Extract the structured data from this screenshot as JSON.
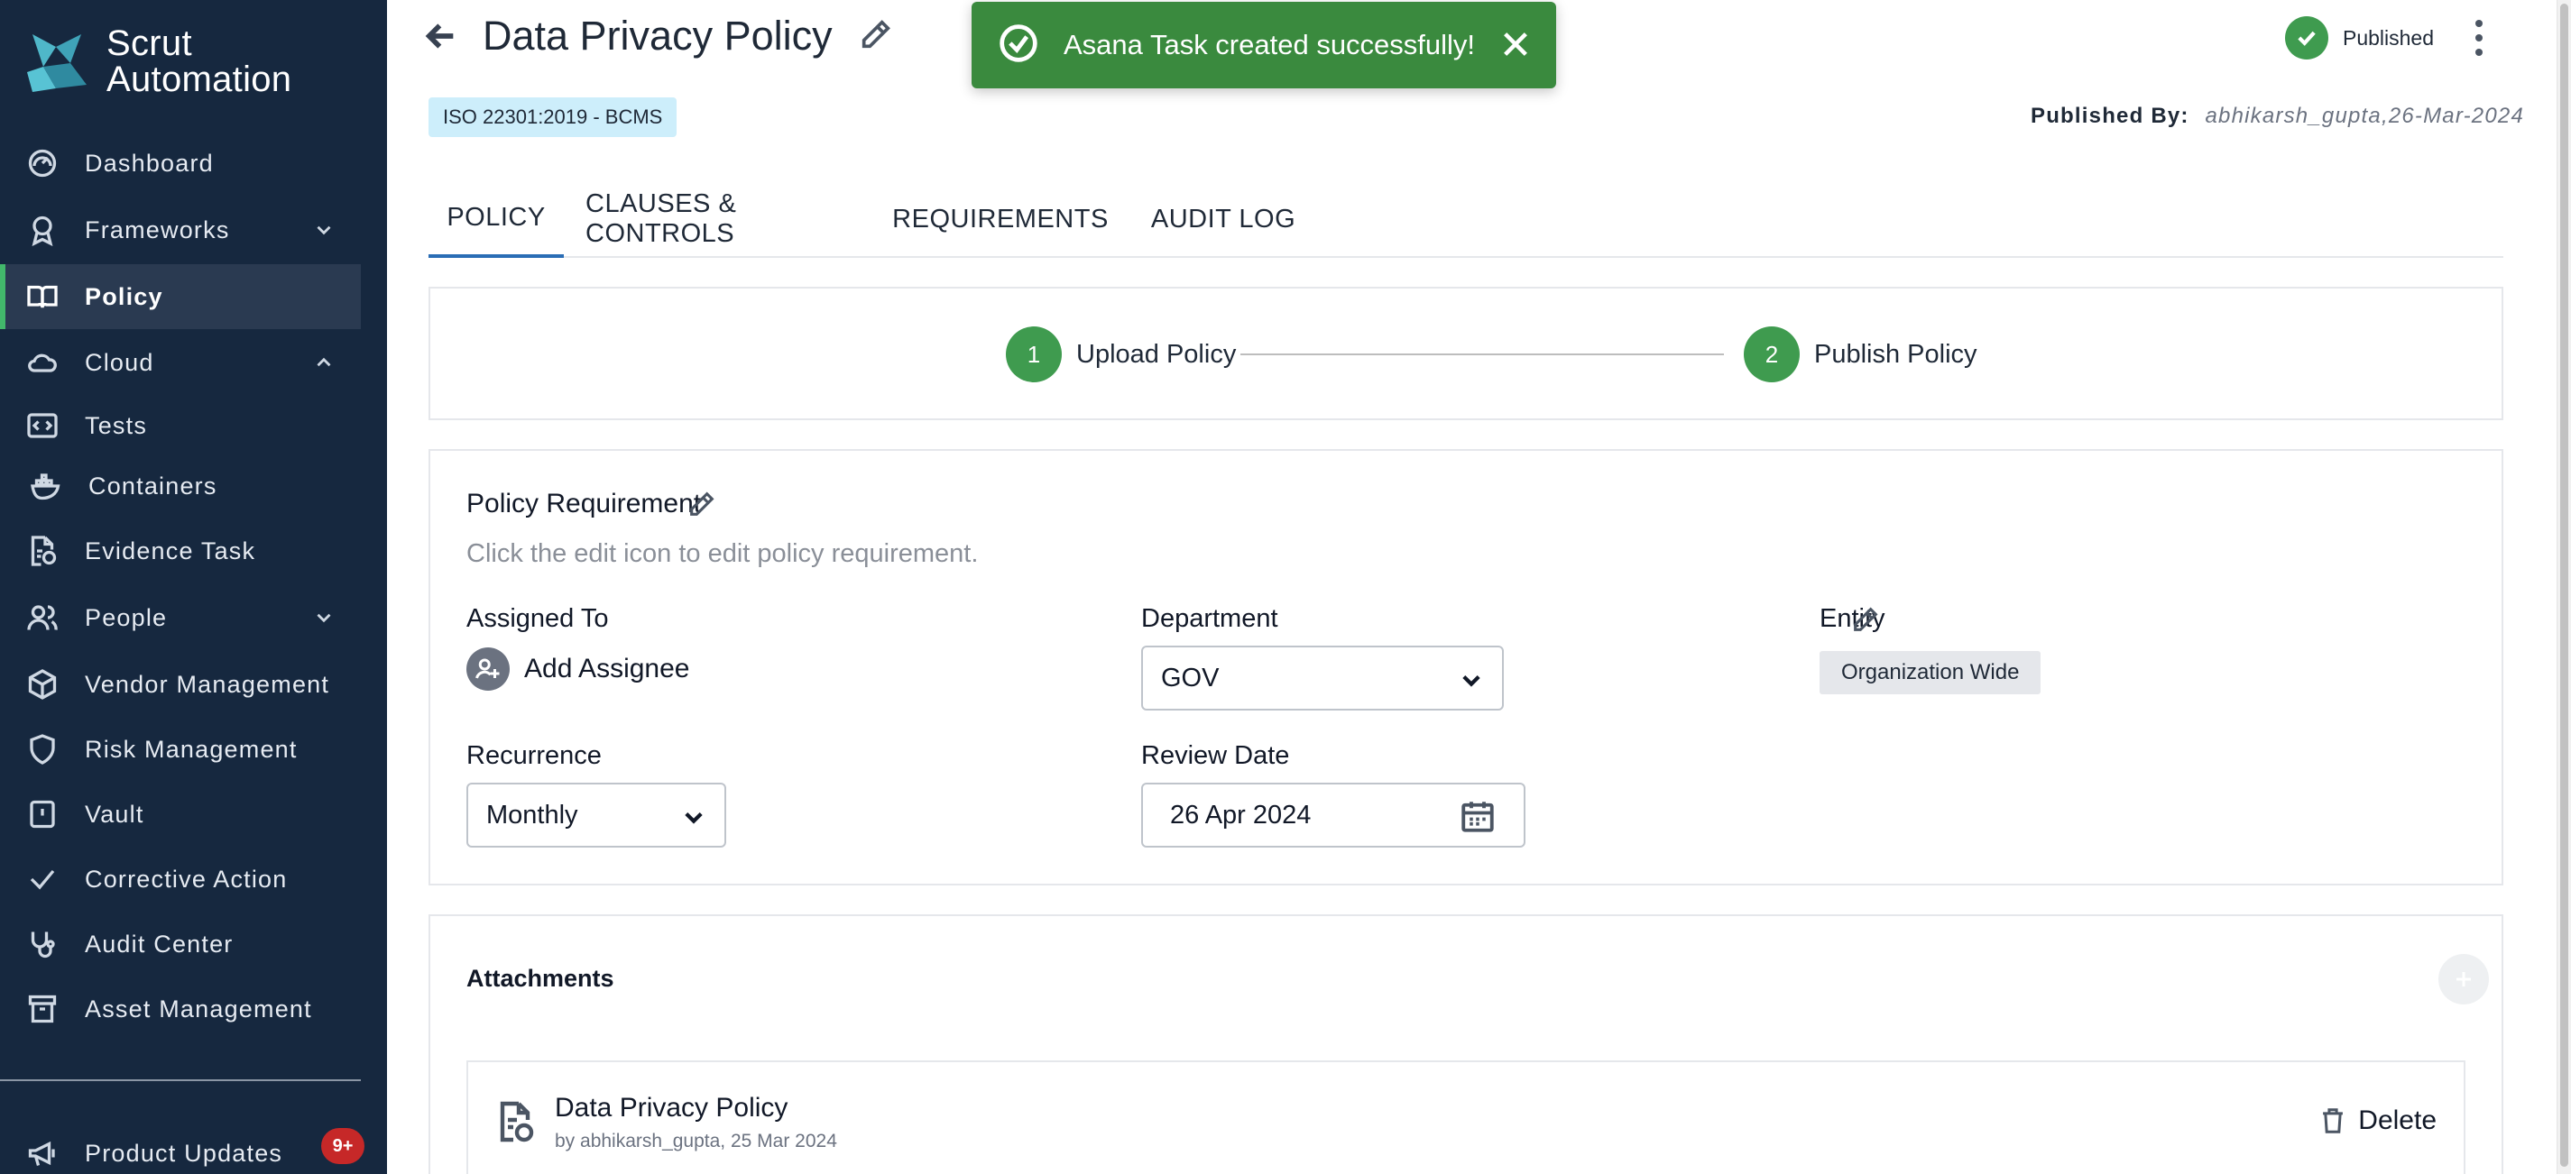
{
  "brand": {
    "name_line1": "Scrut",
    "name_line2": "Automation"
  },
  "sidebar": {
    "items": [
      {
        "label": "Dashboard",
        "icon": "dashboard-icon"
      },
      {
        "label": "Frameworks",
        "icon": "award-icon",
        "chevron": "down"
      },
      {
        "label": "Policy",
        "icon": "book-icon",
        "active": true
      },
      {
        "label": "Cloud",
        "icon": "cloud-icon",
        "chevron": "up"
      },
      {
        "label": "Tests",
        "icon": "code-icon"
      },
      {
        "label": "Containers",
        "icon": "docker-icon"
      },
      {
        "label": "Evidence Task",
        "icon": "document-check-icon"
      },
      {
        "label": "People",
        "icon": "people-icon",
        "chevron": "down"
      },
      {
        "label": "Vendor Management",
        "icon": "box-icon"
      },
      {
        "label": "Risk Management",
        "icon": "shield-icon"
      },
      {
        "label": "Vault",
        "icon": "vault-icon"
      },
      {
        "label": "Corrective Action",
        "icon": "check-icon"
      },
      {
        "label": "Audit Center",
        "icon": "stethoscope-icon"
      },
      {
        "label": "Asset Management",
        "icon": "archive-icon"
      }
    ],
    "product_updates": {
      "label": "Product Updates",
      "icon": "megaphone-icon",
      "badge": "9+"
    }
  },
  "header": {
    "title": "Data Privacy Policy",
    "framework_tag": "ISO 22301:2019 - BCMS",
    "status": "Published",
    "published_by_label": "Published By:",
    "published_by_value": "abhikarsh_gupta,26-Mar-2024"
  },
  "toast": {
    "message": "Asana Task created successfully!",
    "color": "#3a8a3e"
  },
  "tabs": [
    {
      "label": "POLICY",
      "active": true
    },
    {
      "label": "CLAUSES & CONTROLS"
    },
    {
      "label": "REQUIREMENTS"
    },
    {
      "label": "AUDIT LOG"
    }
  ],
  "stepper": {
    "steps": [
      {
        "number": "1",
        "label": "Upload Policy"
      },
      {
        "number": "2",
        "label": "Publish Policy"
      }
    ]
  },
  "requirement": {
    "title": "Policy Requirement",
    "hint": "Click the edit icon to edit policy requirement.",
    "assigned_to_label": "Assigned To",
    "add_assignee": "Add Assignee",
    "department_label": "Department",
    "department_value": "GOV",
    "entity_label": "Entity",
    "entity_value": "Organization Wide",
    "recurrence_label": "Recurrence",
    "recurrence_value": "Monthly",
    "review_date_label": "Review Date",
    "review_date_value": "26 Apr 2024"
  },
  "attachments": {
    "title": "Attachments",
    "items": [
      {
        "name": "Data Privacy Policy",
        "meta": "by abhikarsh_gupta, 25 Mar 2024",
        "delete_label": "Delete"
      }
    ]
  },
  "colors": {
    "sidebar_bg": "#16283f",
    "accent_green": "#3f9b4f",
    "tab_active": "#2a6db5"
  }
}
